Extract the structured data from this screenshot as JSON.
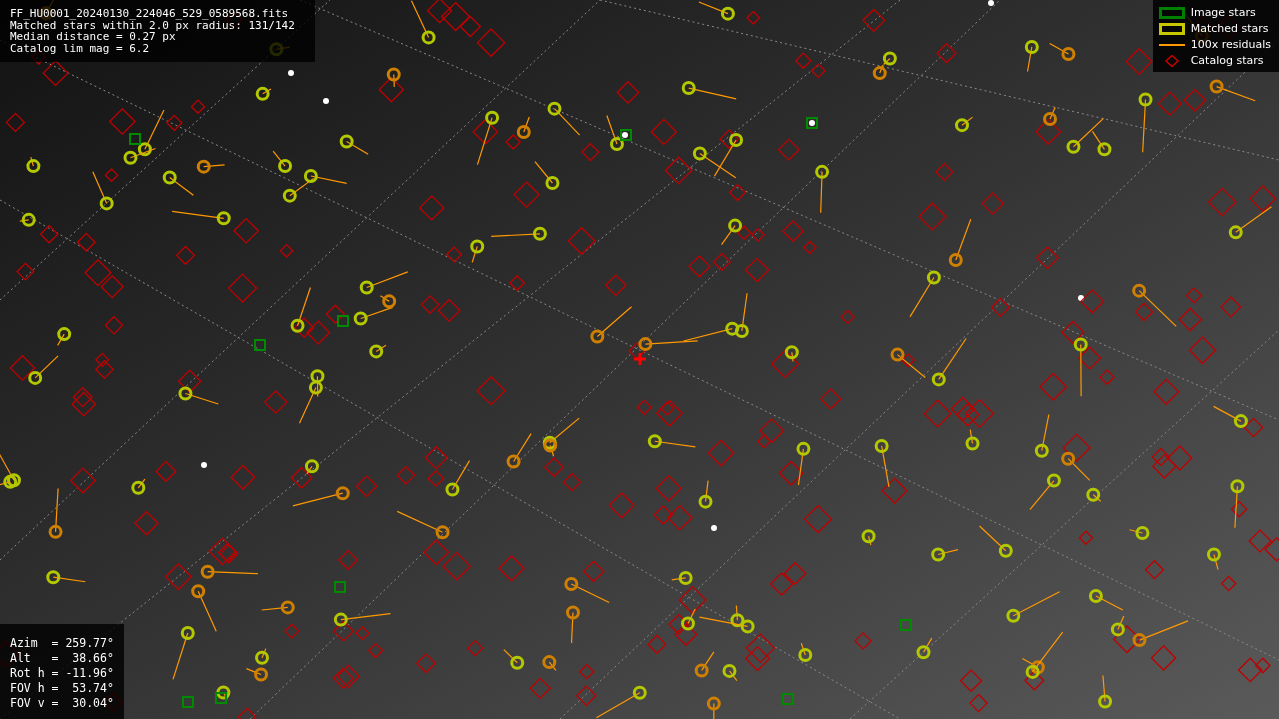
{
  "info_lines": [
    "FF_HU0001_20240130_224046_529_0589568.fits",
    "Matched stars within 2.0 px radius: 131/142",
    "Median distance = 0.27 px",
    "Catalog lim mag = 6.2"
  ],
  "legend": [
    {
      "label": "Image stars",
      "color": "#008000"
    },
    {
      "kind": "matched",
      "label": "Matched stars",
      "color": "#c8c800"
    },
    {
      "kind": "residual",
      "label": "100x residuals",
      "color": "#ff9900"
    },
    {
      "kind": "catalog",
      "label": "Catalog stars",
      "color": "#cc0000"
    }
  ],
  "pointing": [
    "Azim  = 259.77°",
    "Alt   =  38.66°",
    "Rot h = -11.96°",
    "FOV h =  53.74°",
    "FOV v =  30.04°"
  ]
}
